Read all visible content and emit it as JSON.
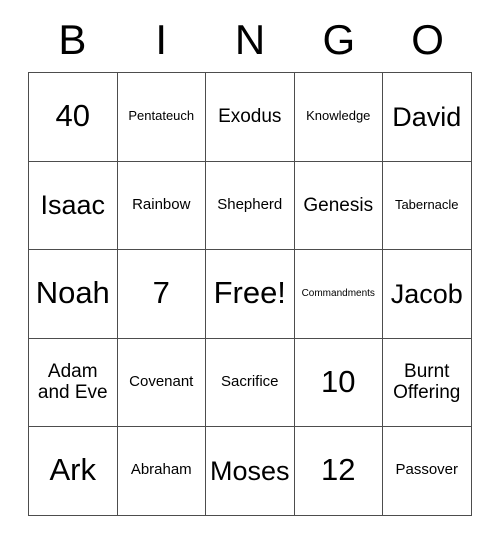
{
  "card": {
    "header_letters": [
      "B",
      "I",
      "N",
      "G",
      "O"
    ],
    "free_space_label": "Free!",
    "colors": {
      "background": "#ffffff",
      "grid_line": "#4d4d4d",
      "text": "#000000"
    },
    "rows": [
      [
        {
          "text": "40",
          "size": "fs-xxl"
        },
        {
          "text": "Pentateuch",
          "size": "fs-xs"
        },
        {
          "text": "Exodus",
          "size": "fs-m"
        },
        {
          "text": "Knowledge",
          "size": "fs-xs"
        },
        {
          "text": "David",
          "size": "fs-xl"
        }
      ],
      [
        {
          "text": "Isaac",
          "size": "fs-xl"
        },
        {
          "text": "Rainbow",
          "size": "fs-s"
        },
        {
          "text": "Shepherd",
          "size": "fs-s"
        },
        {
          "text": "Genesis",
          "size": "fs-m"
        },
        {
          "text": "Tabernacle",
          "size": "fs-xs"
        }
      ],
      [
        {
          "text": "Noah",
          "size": "fs-xxl"
        },
        {
          "text": "7",
          "size": "fs-xxl"
        },
        {
          "text": "Free!",
          "size": "fs-xxl"
        },
        {
          "text": "Commandments",
          "size": "fs-xxs"
        },
        {
          "text": "Jacob",
          "size": "fs-xl"
        }
      ],
      [
        {
          "text": "Adam and Eve",
          "size": "fs-m"
        },
        {
          "text": "Covenant",
          "size": "fs-s"
        },
        {
          "text": "Sacrifice",
          "size": "fs-s"
        },
        {
          "text": "10",
          "size": "fs-xxl"
        },
        {
          "text": "Burnt Offering",
          "size": "fs-m"
        }
      ],
      [
        {
          "text": "Ark",
          "size": "fs-xxl"
        },
        {
          "text": "Abraham",
          "size": "fs-s"
        },
        {
          "text": "Moses",
          "size": "fs-xl"
        },
        {
          "text": "12",
          "size": "fs-xxl"
        },
        {
          "text": "Passover",
          "size": "fs-s"
        }
      ]
    ]
  }
}
